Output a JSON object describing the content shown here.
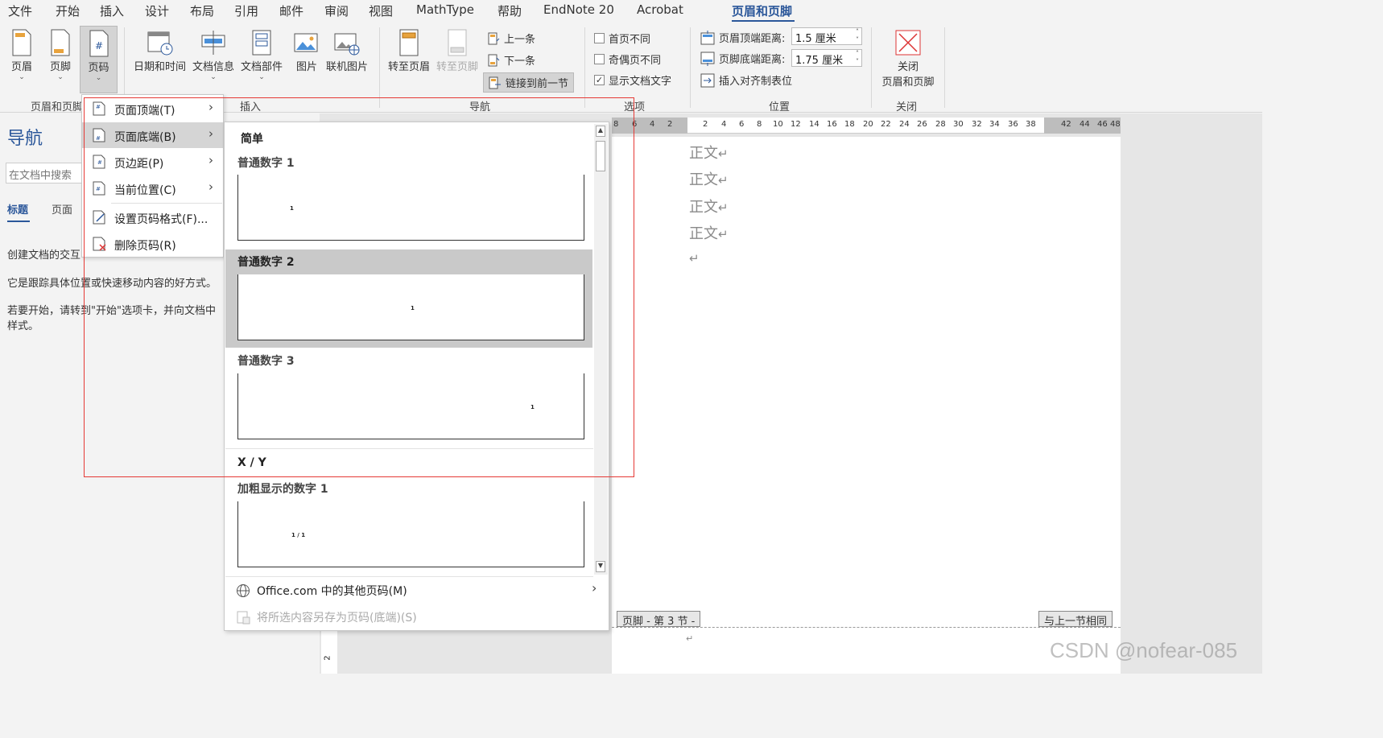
{
  "tabs": [
    "文件",
    "开始",
    "插入",
    "设计",
    "布局",
    "引用",
    "邮件",
    "审阅",
    "视图",
    "MathType",
    "帮助",
    "EndNote 20",
    "Acrobat",
    "页眉和页脚"
  ],
  "ribbon": {
    "header_label": "页眉",
    "footer_label": "页脚",
    "page_number_label": "页码",
    "group_header_footer": "页眉和页脚",
    "date_time_label": "日期和时间",
    "doc_info_label": "文档信息",
    "doc_parts_label": "文档部件",
    "picture_label": "图片",
    "online_picture_label": "联机图片",
    "group_insert": "插入",
    "goto_header_label": "转至页眉",
    "goto_footer_label": "转至页脚",
    "previous_label": "上一条",
    "next_label": "下一条",
    "link_previous_label": "链接到前一节",
    "group_navigation": "导航",
    "different_first_page": "首页不同",
    "different_odd_even": "奇偶页不同",
    "show_doc_text": "显示文档文字",
    "show_doc_text_checked": "✓",
    "group_options": "选项",
    "header_top_label": "页眉顶端距离:",
    "header_top_value": "1.5 厘米",
    "footer_bottom_label": "页脚底端距离:",
    "footer_bottom_value": "1.75 厘米",
    "insert_align_tab": "插入对齐制表位",
    "group_position": "位置",
    "close_label_1": "关闭",
    "close_label_2": "页眉和页脚",
    "group_close": "关闭"
  },
  "nav": {
    "title": "导航",
    "search_placeholder": "在文档中搜索",
    "tab_headings": "标题",
    "tab_pages": "页面",
    "text1": "创建文档的交互",
    "text2": "它是跟踪具体位置或快速移动内容的好方式。",
    "text3": "若要开始，请转到\"开始\"选项卡，并向文档中",
    "text4": "样式。"
  },
  "menu": {
    "items": [
      "页面顶端(T)",
      "页面底端(B)",
      "页边距(P)",
      "当前位置(C)",
      "设置页码格式(F)...",
      "删除页码(R)"
    ]
  },
  "gallery": {
    "section_simple": "简单",
    "plain1": "普通数字 1",
    "plain2": "普通数字 2",
    "plain3": "普通数字 3",
    "section_xy": "X / Y",
    "bold1": "加粗显示的数字 1",
    "thumb_num": "1",
    "thumb_xy": "1 / 1",
    "more_office": "Office.com 中的其他页码(M)",
    "save_selection": "将所选内容另存为页码(底端)(S)"
  },
  "ruler": {
    "numbers": [
      "8",
      "6",
      "4",
      "2",
      "2",
      "4",
      "6",
      "8",
      "10",
      "12",
      "14",
      "16",
      "18",
      "20",
      "22",
      "24",
      "26",
      "28",
      "30",
      "32",
      "34",
      "36",
      "38",
      "42",
      "44",
      "46",
      "48"
    ]
  },
  "doc": {
    "body_text": "正文",
    "return_mark": "↵",
    "footer_tag": "页脚 - 第 3 节 -",
    "same_as_previous": "与上一节相同",
    "vruler_num": "2"
  },
  "watermark": "CSDN @nofear-085",
  "colors": {
    "accent": "#2b579a",
    "highlight": "#d5d5d5",
    "red_box": "#e53935"
  }
}
